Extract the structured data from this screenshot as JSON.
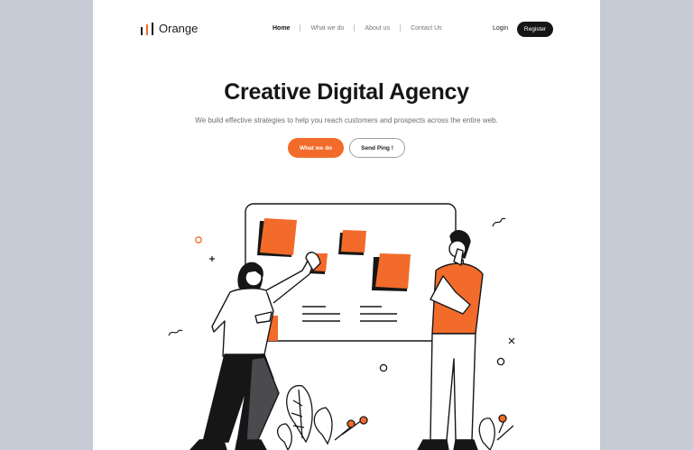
{
  "brand": {
    "name": "Orange",
    "logo_icon": "bar-chart-logo-icon",
    "accent": "#f26b2a",
    "dark": "#161616"
  },
  "nav": {
    "items": [
      {
        "label": "Home",
        "active": true
      },
      {
        "label": "What we do",
        "active": false
      },
      {
        "label": "About us",
        "active": false
      },
      {
        "label": "Contact Us",
        "active": false
      }
    ]
  },
  "auth": {
    "login_label": "Login",
    "register_label": "Register"
  },
  "hero": {
    "title": "Creative Digital Agency",
    "subtitle": "We build effective strategies to help you reach customers and prospects across the entire web.",
    "primary_cta": "What we do",
    "secondary_cta": "Send Ping !",
    "illustration": "team-sticky-notes-board-illustration"
  }
}
